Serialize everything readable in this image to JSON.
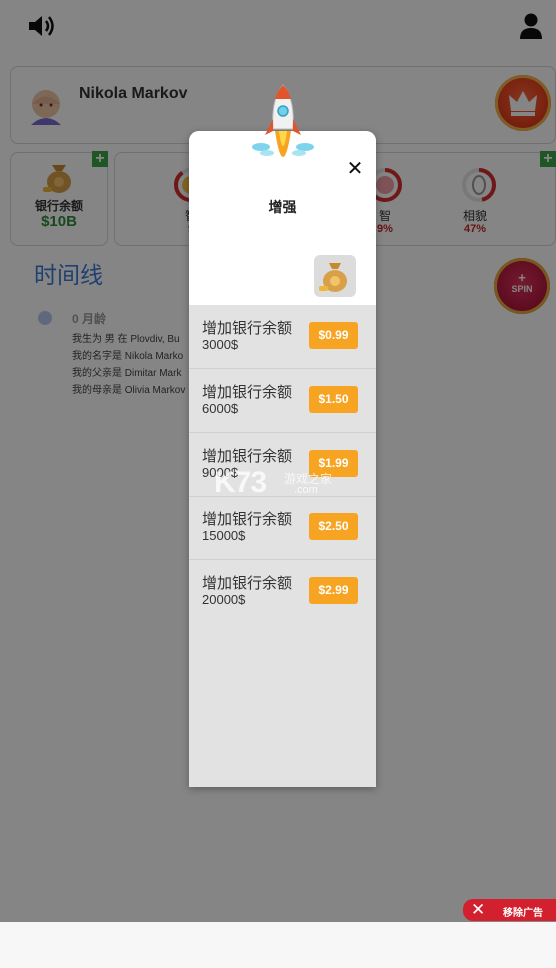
{
  "profile": {
    "name": "Nikola Markov"
  },
  "stats": {
    "bank_label": "银行余额",
    "bank_value": "$10B",
    "gauges": [
      {
        "label": "智",
        "value": "9"
      },
      {
        "label": "智",
        "value": "9%"
      },
      {
        "label": "相貌",
        "value": "47%"
      }
    ]
  },
  "timeline": {
    "title": "时间线",
    "age": "0 月龄",
    "lines": [
      "我生为 男 在 Plovdiv, Bu",
      "我的名字是 Nikola Marko",
      "我的父亲是 Dimitar Mark",
      "我的母亲是 Olivia Markov"
    ]
  },
  "spin": {
    "plus": "+",
    "label": "SPIN"
  },
  "modal": {
    "title": "增强",
    "close": "✕",
    "items": [
      {
        "name": "增加银行余额",
        "amount": "3000$",
        "price": "$0.99"
      },
      {
        "name": "增加银行余额",
        "amount": "6000$",
        "price": "$1.50"
      },
      {
        "name": "增加银行余额",
        "amount": "9000$",
        "price": "$1.99"
      },
      {
        "name": "增加银行余额",
        "amount": "15000$",
        "price": "$2.50"
      },
      {
        "name": "增加银行余额",
        "amount": "20000$",
        "price": "$2.99"
      }
    ]
  },
  "watermark": {
    "big": "K73",
    "small1": "游戏之家",
    "small2": ".com"
  },
  "ad": {
    "close": "✕",
    "label": "移除广告"
  }
}
